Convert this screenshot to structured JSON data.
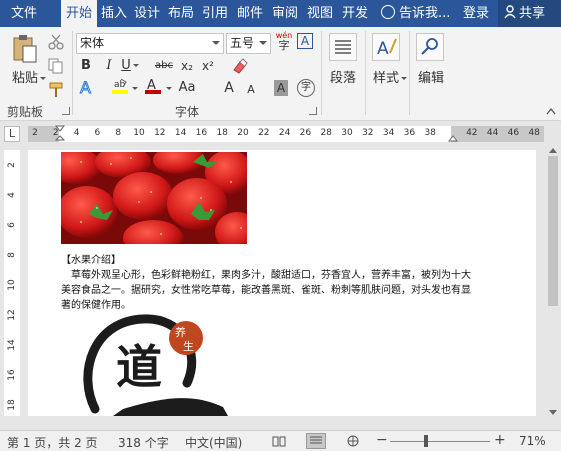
{
  "tabs": [
    "文件",
    "开始",
    "插入",
    "设计",
    "布局",
    "引用",
    "邮件",
    "审阅",
    "视图",
    "开发"
  ],
  "tellme": "告诉我...",
  "login": "登录",
  "share": "共享",
  "ribbon": {
    "paste": "粘贴",
    "clipboard": "剪贴板",
    "font_name": "宋体",
    "font_size": "五号",
    "wen": "wén",
    "font_group": "字体",
    "paragraph": "段落",
    "style": "样式",
    "edit": "编辑",
    "bold": "B",
    "italic": "I",
    "underline": "U",
    "strike": "abc",
    "subscript": "x₂",
    "superscript": "x²",
    "grow": "A",
    "shrink": "A",
    "charcase": "Aa",
    "shade": "A",
    "encircle": "字",
    "border_a": "A"
  },
  "ruler": {
    "corner": "L",
    "ticks": [
      "2",
      "2",
      "4",
      "6",
      "8",
      "10",
      "12",
      "14",
      "16",
      "18",
      "20",
      "22",
      "24",
      "26",
      "28",
      "30",
      "32",
      "34",
      "36",
      "38",
      "",
      "42",
      "44",
      "46",
      "48"
    ],
    "vticks": [
      "2",
      "4",
      "6",
      "8",
      "10",
      "12",
      "14",
      "16",
      "18"
    ]
  },
  "document": {
    "heading": "【水果介绍】",
    "body": "草莓外观呈心形，色彩鲜艳粉红，果肉多汁，酸甜适口，芬香宜人，营养丰富，被列为十大美容食品之一。据研究，女性常吃草莓，能改善黑斑、雀斑、粉刺等肌肤问题，对头发也有显著的保健作用。",
    "logo_stamp": "养生",
    "logo_char": "道"
  },
  "status": {
    "page": "第 1 页，共 2 页",
    "words": "318 个字",
    "lang": "中文(中国)",
    "zoom": "71%",
    "zoom_minus": "−",
    "zoom_plus": "+"
  },
  "colors": {
    "tabbar": "#2b579a",
    "highlight": "#ffff00",
    "fontcolor": "#c00000"
  }
}
